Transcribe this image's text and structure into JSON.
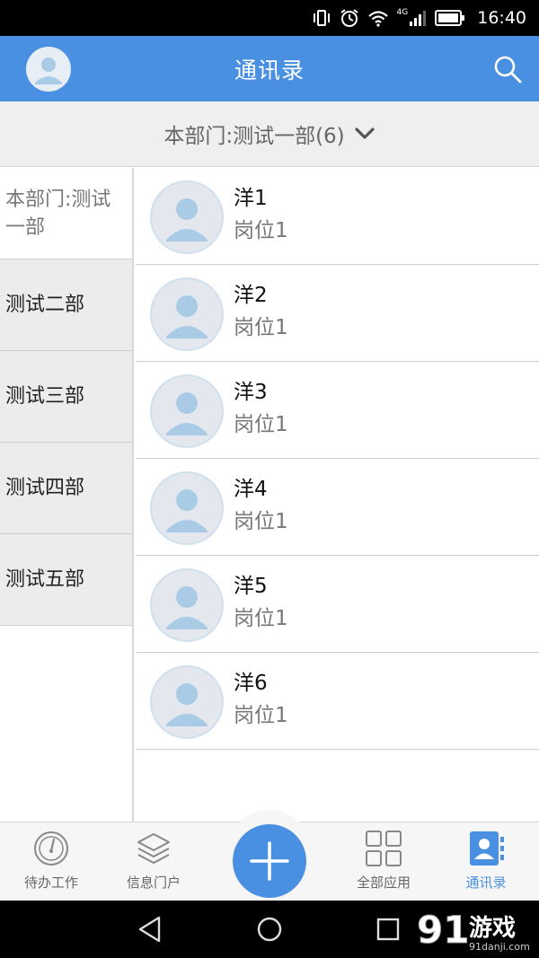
{
  "status_bar": {
    "time": "16:40",
    "network": "4G"
  },
  "header": {
    "title": "通讯录"
  },
  "department_selector": {
    "label": "本部门:测试一部(6)"
  },
  "departments": [
    {
      "label": "本部门:测试一部",
      "active": true
    },
    {
      "label": "测试二部",
      "active": false
    },
    {
      "label": "测试三部",
      "active": false
    },
    {
      "label": "测试四部",
      "active": false
    },
    {
      "label": "测试五部",
      "active": false
    }
  ],
  "contacts": [
    {
      "name": "洋1",
      "position": "岗位1"
    },
    {
      "name": "洋2",
      "position": "岗位1"
    },
    {
      "name": "洋3",
      "position": "岗位1"
    },
    {
      "name": "洋4",
      "position": "岗位1"
    },
    {
      "name": "洋5",
      "position": "岗位1"
    },
    {
      "name": "洋6",
      "position": "岗位1"
    }
  ],
  "tabs": [
    {
      "label": "待办工作",
      "icon": "gauge-icon"
    },
    {
      "label": "信息门户",
      "icon": "layers-icon"
    },
    {
      "label": "全部应用",
      "icon": "grid-icon"
    },
    {
      "label": "通讯录",
      "icon": "contact-card-icon",
      "active": true
    }
  ],
  "watermark": {
    "brand": "游戏",
    "number": "91",
    "domain": "91danji.com"
  },
  "colors": {
    "primary": "#4a90e2",
    "status_bar": "#000000",
    "tab_active": "#4a90e2",
    "avatar_figure": "#a9cbe6"
  }
}
